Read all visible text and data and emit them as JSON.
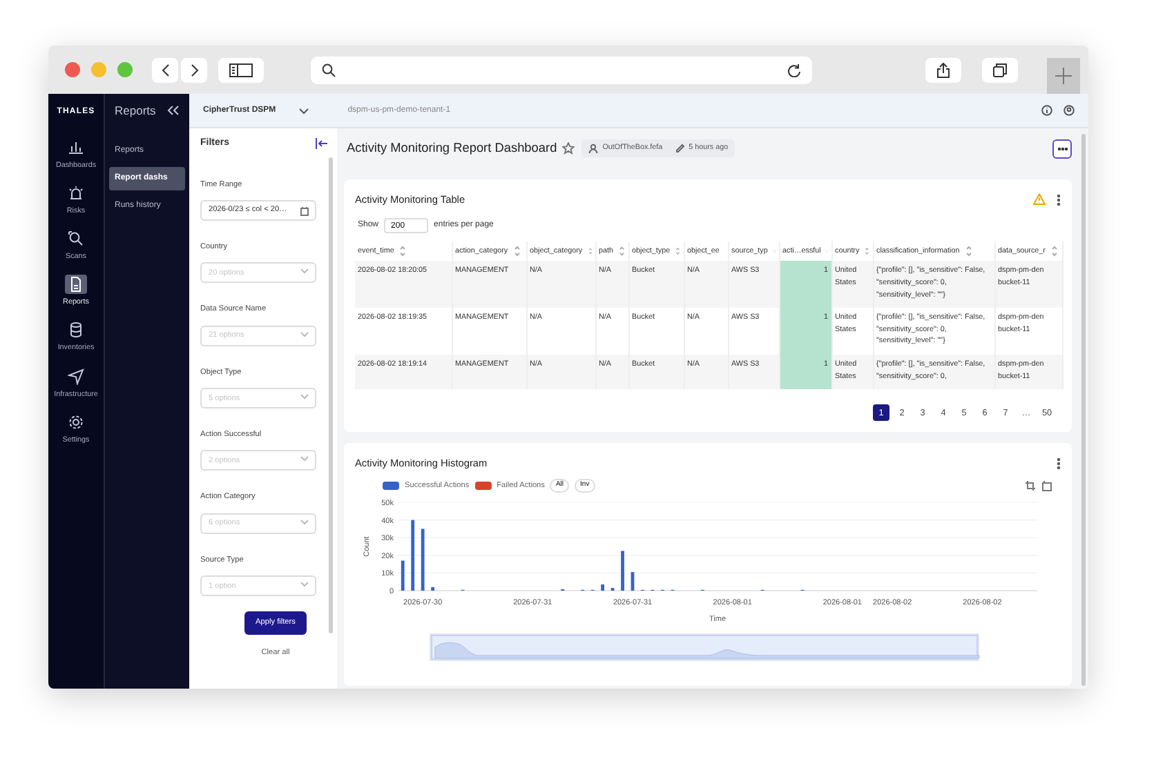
{
  "rail": {
    "logo": "THALES",
    "items": [
      {
        "label": "Dashboards",
        "selected": false
      },
      {
        "label": "Risks",
        "selected": false
      },
      {
        "label": "Scans",
        "selected": false
      },
      {
        "label": "Reports",
        "selected": true
      },
      {
        "label": "Inventories",
        "selected": false
      },
      {
        "label": "Infrastructure",
        "selected": false
      },
      {
        "label": "Settings",
        "selected": false
      }
    ]
  },
  "subnav": {
    "title": "Reports",
    "items": [
      {
        "label": "Reports",
        "selected": false
      },
      {
        "label": "Report dashs",
        "selected": true
      },
      {
        "label": "Runs history",
        "selected": false
      }
    ]
  },
  "header": {
    "product": "CipherTrust DSPM",
    "tenant": "dspm-us-pm-demo-tenant-1"
  },
  "filters": {
    "title": "Filters",
    "fields": [
      {
        "label": "Time Range",
        "kind": "text",
        "value": "2026-0/23 ≤ col < 20…"
      },
      {
        "label": "Country",
        "kind": "select",
        "placeholder": "20 options"
      },
      {
        "label": "Data Source Name",
        "kind": "select",
        "placeholder": "21 options"
      },
      {
        "label": "Object Type",
        "kind": "select",
        "placeholder": "5 options"
      },
      {
        "label": "Action Successful",
        "kind": "select",
        "placeholder": "2 options"
      },
      {
        "label": "Action Category",
        "kind": "select",
        "placeholder": "6 options"
      },
      {
        "label": "Source Type",
        "kind": "select",
        "placeholder": "1 option"
      }
    ],
    "apply": "Apply filters",
    "clear": "Clear all"
  },
  "dashboard": {
    "title": "Activity Monitoring Report Dashboard",
    "starred": false,
    "owner": "OutOfTheBox.fefa",
    "modified": "5 hours ago"
  },
  "table_card": {
    "title": "Activity Monitoring Table",
    "show_label": "Show",
    "page_size": "200",
    "per_page_label": "entries per page",
    "columns": [
      {
        "label": "event_time",
        "kind": "text"
      },
      {
        "label": "action_category",
        "kind": "text"
      },
      {
        "label": "object_category",
        "kind": "text"
      },
      {
        "label": "path",
        "kind": "text"
      },
      {
        "label": "object_type",
        "kind": "text"
      },
      {
        "label": "object_ee",
        "kind": "text"
      },
      {
        "label": "source_typ",
        "kind": "text"
      },
      {
        "label": "acti…essful",
        "kind": "bar"
      },
      {
        "label": "country",
        "kind": "text"
      },
      {
        "label": "classification_information",
        "kind": "text"
      },
      {
        "label": "data_source_r",
        "kind": "text"
      }
    ],
    "rows": [
      {
        "level": 1,
        "cells": [
          "2026-08-02 18:20:05",
          "MANAGEMENT",
          "N/A",
          "N/A",
          "Bucket",
          "N/A",
          "AWS S3",
          "1",
          "United States",
          "{\"profile\": [], \"is_sensitive\": False, \"sensitivity_score\": 0, \"sensitivity_level\": \"\"}",
          "dspm-pm-den bucket-11"
        ]
      },
      {
        "level": 1,
        "cells": [
          "2026-08-02 18:19:35",
          "MANAGEMENT",
          "N/A",
          "N/A",
          "Bucket",
          "N/A",
          "AWS S3",
          "1",
          "United States",
          "{\"profile\": [], \"is_sensitive\": False, \"sensitivity_score\": 0, \"sensitivity_level\": \"\"}",
          "dspm-pm-den bucket-11"
        ]
      },
      {
        "level": 1,
        "cells": [
          "2026-08-02 18:19:14",
          "MANAGEMENT",
          "N/A",
          "N/A",
          "Bucket",
          "N/A",
          "AWS S3",
          "1",
          "United States",
          "{\"profile\": [], \"is_sensitive\": False, \"sensitivity_score\": 0,",
          "dspm-pm-den bucket-11"
        ]
      }
    ],
    "pages": [
      {
        "label": "1",
        "selected": true
      },
      {
        "label": "2",
        "selected": false
      },
      {
        "label": "3",
        "selected": false
      },
      {
        "label": "4",
        "selected": false
      },
      {
        "label": "5",
        "selected": false
      },
      {
        "label": "6",
        "selected": false
      },
      {
        "label": "7",
        "selected": false
      },
      {
        "label": "…",
        "selected": false
      },
      {
        "label": "50",
        "selected": false
      }
    ]
  },
  "histogram": {
    "title": "Activity Monitoring Histogram",
    "toggles": [
      "All",
      "Inv"
    ],
    "range": {
      "level": 1
    },
    "chart_data": {
      "type": "bar",
      "xlabel": "Time",
      "ylabel": "Count",
      "categories": [
        null,
        null,
        "2026-07-30",
        null,
        null,
        null,
        null,
        null,
        null,
        null,
        null,
        null,
        null,
        "2026-07-31",
        null,
        null,
        null,
        null,
        null,
        null,
        null,
        null,
        null,
        "2026-07-31",
        null,
        null,
        null,
        null,
        null,
        null,
        null,
        null,
        null,
        "2026-08-01",
        null,
        null,
        null,
        null,
        null,
        null,
        null,
        null,
        null,
        null,
        "2026-08-01",
        null,
        null,
        null,
        null,
        "2026-08-02",
        null,
        null,
        null,
        null,
        null,
        null,
        null,
        null,
        "2026-08-02",
        null,
        null,
        null,
        null,
        null
      ],
      "series": [
        {
          "name": "Successful Actions",
          "color": "#3563c9",
          "values": [
            17000,
            40000,
            35000,
            2000,
            null,
            null,
            200,
            null,
            null,
            null,
            null,
            null,
            null,
            null,
            null,
            null,
            800,
            null,
            300,
            400,
            3500,
            1500,
            22500,
            10500,
            400,
            300,
            300,
            300,
            null,
            null,
            300,
            null,
            null,
            null,
            null,
            null,
            200,
            null,
            null,
            null,
            200,
            null,
            null,
            null,
            null,
            null,
            null,
            null,
            null,
            null,
            null,
            null,
            null,
            null,
            null,
            null,
            null,
            null,
            null,
            null,
            null,
            null,
            null,
            null
          ]
        },
        {
          "name": "Failed Actions",
          "color": "#d9432b",
          "values": [
            null,
            null,
            null,
            null,
            null,
            null,
            null,
            null,
            null,
            null,
            null,
            null,
            null,
            null,
            null,
            null,
            null,
            null,
            null,
            null,
            null,
            null,
            null,
            null,
            null,
            null,
            null,
            null,
            null,
            null,
            null,
            null,
            null,
            null,
            null,
            null,
            null,
            null,
            null,
            null,
            null,
            null,
            null,
            null,
            null,
            null,
            null,
            null,
            null,
            null,
            null,
            null,
            null,
            null,
            null,
            null,
            null,
            null,
            null,
            null,
            null,
            null,
            null,
            null
          ]
        }
      ],
      "ylim": [
        0,
        50000
      ],
      "grid": true,
      "yticks": [
        {
          "value": 0,
          "label": "0"
        },
        {
          "value": 10000,
          "label": "10k"
        },
        {
          "value": 20000,
          "label": "20k"
        },
        {
          "value": 30000,
          "label": "30k"
        },
        {
          "value": 40000,
          "label": "40k"
        },
        {
          "value": 50000,
          "label": "50k"
        }
      ]
    }
  }
}
